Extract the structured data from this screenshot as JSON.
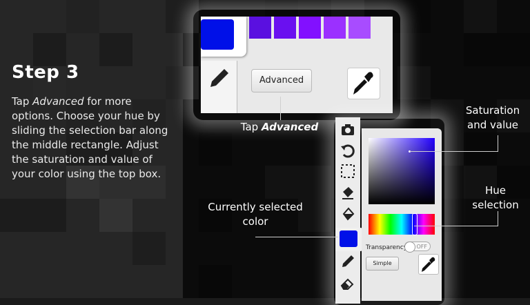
{
  "step": {
    "title": "Step 3",
    "body_pre": "Tap ",
    "body_em": "Advanced",
    "body_post": " for more options. Choose your hue by sliding the selection bar along the middle rectangle. Adjust the saturation and value of your color using the top box."
  },
  "top_panel": {
    "advanced_button": "Advanced",
    "swatch_colors": [
      "#5a10e0",
      "#6a10f0",
      "#8210ff",
      "#9b30ff",
      "#a84cff"
    ],
    "selected_color": "#0010e8"
  },
  "labels": {
    "tap_pre": "Tap ",
    "tap_em": "Advanced",
    "saturation_value": "Saturation and value",
    "hue_selection": "Hue selection",
    "currently_selected": "Currently selected color"
  },
  "advanced_panel": {
    "transparency_label": "Transparency",
    "toggle_text": "OFF",
    "simple_button": "Simple"
  },
  "icons": [
    "camera-icon",
    "undo-icon",
    "selection-icon",
    "bucket-icon",
    "fill-icon",
    "pencil-icon",
    "eraser-icon",
    "eyedropper-icon"
  ]
}
